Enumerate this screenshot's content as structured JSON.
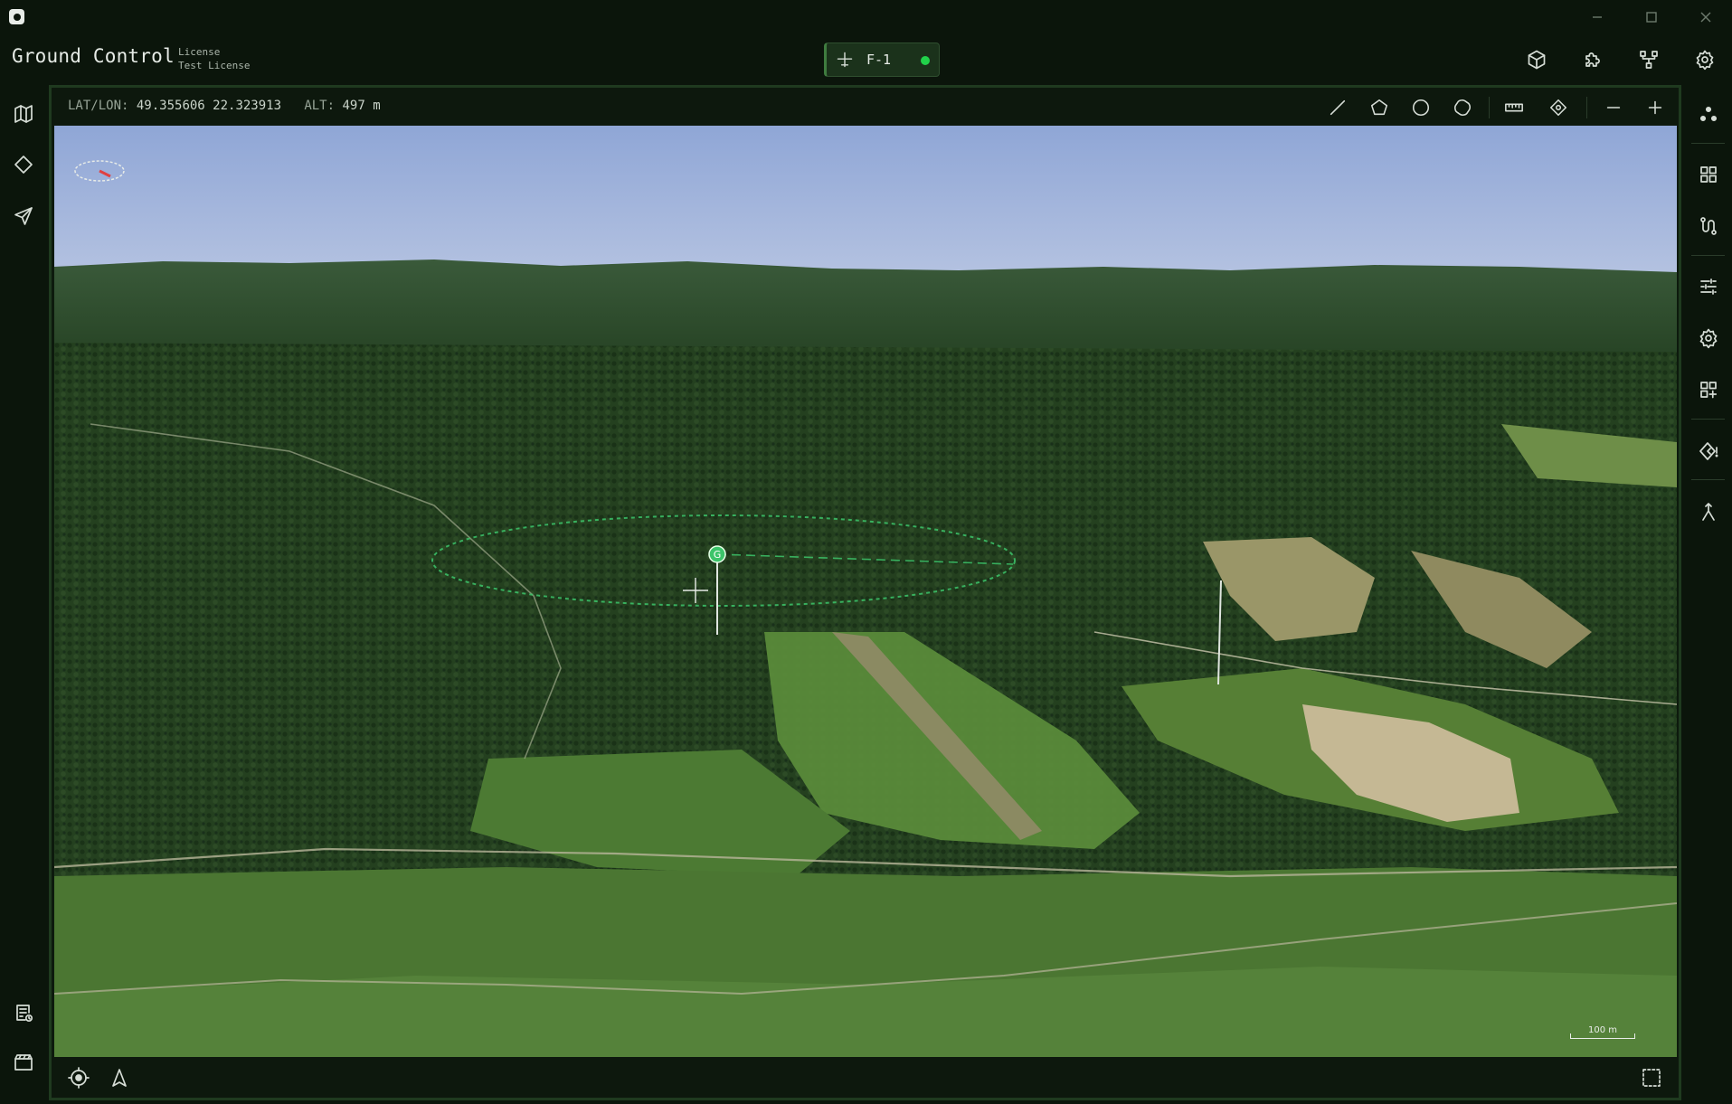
{
  "window": {
    "controls": [
      {
        "name": "minimize",
        "icon": "minimize-icon"
      },
      {
        "name": "maximize",
        "icon": "maximize-icon"
      },
      {
        "name": "close",
        "icon": "close-icon"
      }
    ]
  },
  "header": {
    "title": "Ground Control",
    "license_label": "License",
    "license_value": "Test License",
    "vehicle": {
      "label": "F-1",
      "icon": "drone-icon",
      "status_color": "#21d14a"
    },
    "actions": [
      {
        "name": "3d-view",
        "icon": "cube-icon"
      },
      {
        "name": "plugins",
        "icon": "puzzle-icon"
      },
      {
        "name": "network",
        "icon": "network-icon"
      },
      {
        "name": "settings",
        "icon": "gear-icon"
      }
    ]
  },
  "left_sidebar": {
    "top": [
      {
        "name": "map",
        "icon": "map-icon"
      },
      {
        "name": "geofence",
        "icon": "diamond-icon"
      },
      {
        "name": "navigate",
        "icon": "send-icon"
      }
    ],
    "bottom": [
      {
        "name": "log",
        "icon": "log-icon"
      },
      {
        "name": "clapperboard",
        "icon": "clapperboard-icon"
      }
    ]
  },
  "map_toolbar": {
    "lat_lon_label": "LAT/LON:",
    "lat_lon_value": "49.355606 22.323913",
    "alt_label": "ALT:",
    "alt_value": "497 m",
    "tools": [
      {
        "name": "draw-line",
        "icon": "line-icon"
      },
      {
        "name": "draw-polygon",
        "icon": "pentagon-icon"
      },
      {
        "name": "draw-circle",
        "icon": "circle-icon"
      },
      {
        "name": "draw-shape",
        "icon": "blob-icon"
      },
      {
        "name": "measure",
        "icon": "ruler-icon"
      },
      {
        "name": "locate",
        "icon": "crosshair-icon"
      },
      {
        "name": "zoom-out",
        "icon": "minus-icon"
      },
      {
        "name": "zoom-in",
        "icon": "plus-icon"
      }
    ]
  },
  "map": {
    "waypoint_label": "G",
    "scale_label": "100 m",
    "colors": {
      "sky_top": "#8fa6d6",
      "sky_bottom": "#b5c3e1",
      "forest": "#26411f",
      "meadow": "#4f7a34",
      "marker": "#3cc46a"
    }
  },
  "map_bottombar": {
    "left": [
      {
        "name": "center-vehicle",
        "icon": "target-icon"
      },
      {
        "name": "follow-heading",
        "icon": "arrow-up-icon"
      }
    ],
    "right": [
      {
        "name": "area-select",
        "icon": "select-box-icon"
      }
    ]
  },
  "right_sidebar": [
    {
      "name": "vehicles",
      "icon": "nodes-icon"
    },
    {
      "name": "dashboard",
      "icon": "grid-icon"
    },
    {
      "name": "routes",
      "icon": "route-icon"
    },
    {
      "name": "adjustments",
      "icon": "sliders-icon"
    },
    {
      "name": "configuration",
      "icon": "gear-icon"
    },
    {
      "name": "add-widget",
      "icon": "grid-plus-icon"
    },
    {
      "name": "alerts",
      "icon": "diamond-alert-icon"
    },
    {
      "name": "path",
      "icon": "fork-icon"
    }
  ]
}
